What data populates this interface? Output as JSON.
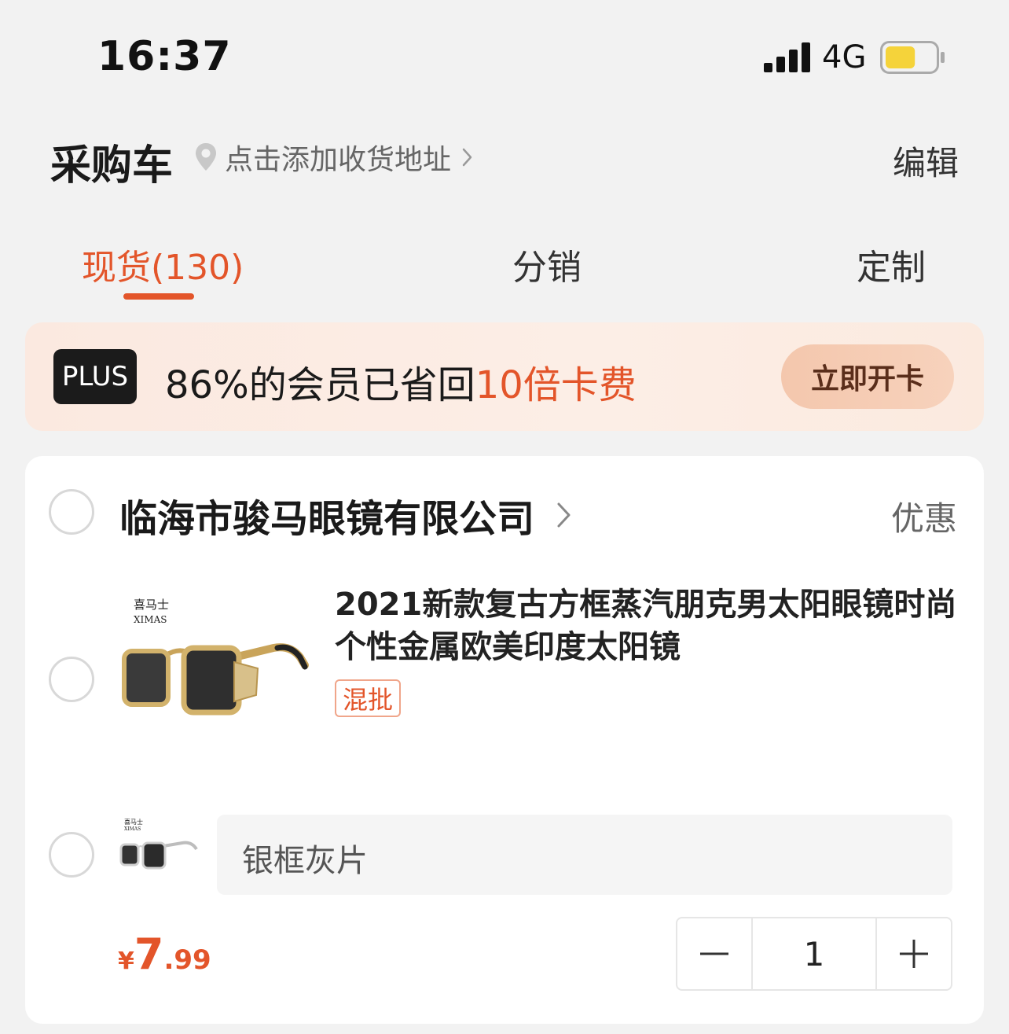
{
  "status_bar": {
    "time": "16:37",
    "network": "4G",
    "battery_level": 0.6,
    "battery_color": "#f5d33a"
  },
  "header": {
    "title": "采购车",
    "address_placeholder": "点击添加收货地址",
    "edit_label": "编辑"
  },
  "tabs": [
    {
      "label": "现货(130)",
      "active": true
    },
    {
      "label": "分销",
      "active": false
    },
    {
      "label": "定制",
      "active": false
    }
  ],
  "plus_banner": {
    "badge": "PLUS",
    "text_prefix": "86%的会员已省回",
    "text_highlight": "10倍卡费",
    "button_label": "立即开卡"
  },
  "shop": {
    "name": "临海市骏马眼镜有限公司",
    "discount_label": "优惠",
    "product": {
      "title": "2021新款复古方框蒸汽朋克男太阳眼镜时尚个性金属欧美印度太阳镜",
      "tag": "混批",
      "image_brand_cn": "喜马士",
      "image_brand_en": "XIMAS",
      "sku": {
        "label": "银框灰片",
        "price_currency": "¥",
        "price_integer": "7",
        "price_decimal": ".99",
        "quantity": "1"
      }
    }
  },
  "colors": {
    "accent": "#e3552a",
    "background": "#f2f2f2"
  },
  "icons": [
    "signal-icon",
    "battery-icon",
    "location-pin-icon",
    "chevron-right-icon",
    "radio-icon",
    "minus-icon",
    "plus-icon"
  ]
}
